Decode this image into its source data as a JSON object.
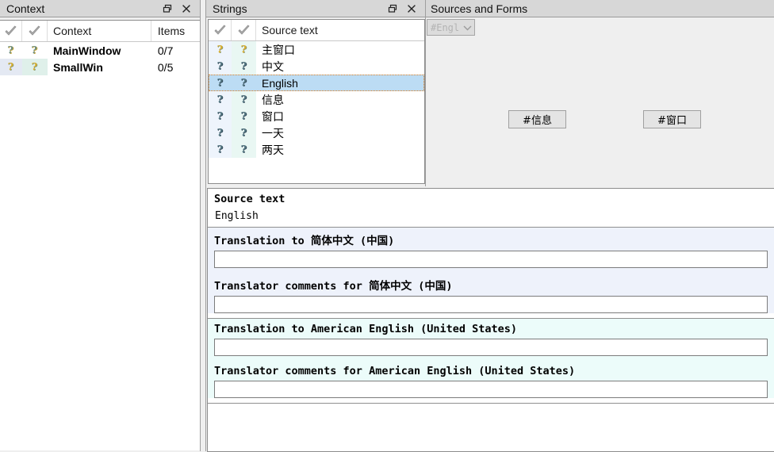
{
  "panels": {
    "context": {
      "title": "Context",
      "float_icon": "restore-icon",
      "close_icon": "close-icon",
      "columns": [
        "",
        "",
        "Context",
        "Items"
      ],
      "header_icons": [
        "check-icon",
        "check-icon"
      ],
      "rows": [
        {
          "icon1": "question-icon",
          "icon2": "question-icon",
          "name": "MainWindow",
          "items": "0/7"
        },
        {
          "icon1": "question-icon",
          "icon2": "question-icon",
          "name": "SmallWin",
          "items": "0/5"
        }
      ]
    },
    "strings": {
      "title": "Strings",
      "float_icon": "restore-icon",
      "close_icon": "close-icon",
      "columns": [
        "",
        "",
        "Source text"
      ],
      "header_icons": [
        "check-icon",
        "check-icon"
      ],
      "rows": [
        {
          "icon1": "question-icon",
          "icon2": "question-icon",
          "text": "主窗口",
          "selected": false
        },
        {
          "icon1": "question-icon",
          "icon2": "question-icon",
          "text": "中文",
          "selected": false
        },
        {
          "icon1": "question-icon",
          "icon2": "question-icon",
          "text": "English",
          "selected": true
        },
        {
          "icon1": "question-icon",
          "icon2": "question-icon",
          "text": "信息",
          "selected": false
        },
        {
          "icon1": "question-icon",
          "icon2": "question-icon",
          "text": "窗口",
          "selected": false
        },
        {
          "icon1": "question-icon",
          "icon2": "question-icon",
          "text": "一天",
          "selected": false
        },
        {
          "icon1": "question-icon",
          "icon2": "question-icon",
          "text": "两天",
          "selected": false
        }
      ]
    },
    "sources_and_forms": {
      "title": "Sources and Forms",
      "combo": {
        "value": "#Engl",
        "arrow_icon": "chevron-down-icon"
      },
      "buttons": [
        {
          "label": "#信息"
        },
        {
          "label": "#窗口"
        }
      ]
    },
    "editor": {
      "source_label": "Source text",
      "source_value": "English",
      "sections": [
        {
          "translation_label": "Translation to 简体中文 (中国)",
          "translation_value": "",
          "comments_label": "Translator comments for 简体中文 (中国)",
          "comments_value": "",
          "tint": "blue"
        },
        {
          "translation_label": "Translation to American English (United States)",
          "translation_value": "",
          "comments_label": "Translator comments for American English (United States)",
          "comments_value": "",
          "tint": "mint"
        }
      ]
    }
  },
  "colors": {
    "panel_title_bg": "#d7d7d7",
    "selection_bg": "#bcdcf4",
    "focus_outline": "#e08020",
    "chinese_tint": "#eef2fb",
    "english_tint": "#ecfcfa",
    "app_bg": "#efefef"
  }
}
